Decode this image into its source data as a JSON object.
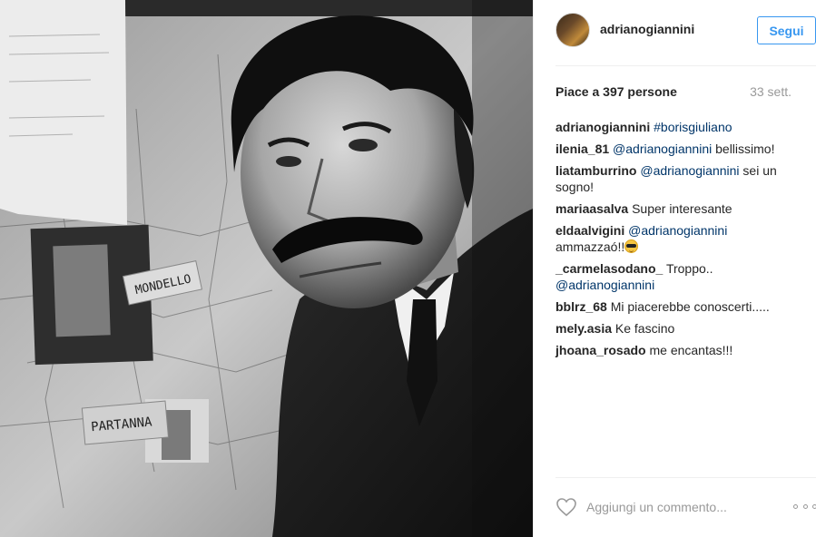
{
  "post": {
    "author": "adrianogiannini",
    "follow_label": "Segui",
    "likes_text": "Piace a 397 persone",
    "time_ago": "33 sett."
  },
  "photo": {
    "description_icon": "photo",
    "note_mondello": "MONDELLO",
    "note_partanna": "PARTANNA"
  },
  "comments": [
    {
      "user": "adrianogiannini",
      "parts": [
        {
          "type": "hashtag",
          "text": "#borisgiuliano"
        }
      ]
    },
    {
      "user": "ilenia_81",
      "parts": [
        {
          "type": "mention",
          "text": "@adrianogiannini"
        },
        {
          "type": "text",
          "text": " bellissimo!"
        }
      ]
    },
    {
      "user": "liatamburrino",
      "parts": [
        {
          "type": "mention",
          "text": "@adrianogiannini"
        },
        {
          "type": "text",
          "text": " sei un sogno!"
        }
      ]
    },
    {
      "user": "mariaasalva",
      "parts": [
        {
          "type": "text",
          "text": "Super interesante"
        }
      ]
    },
    {
      "user": "eldaalvigini",
      "parts": [
        {
          "type": "mention",
          "text": "@adrianogiannini"
        },
        {
          "type": "text",
          "text": " ammazzaó!!"
        },
        {
          "type": "emoji",
          "text": "😎"
        }
      ]
    },
    {
      "user": "_carmelasodano_",
      "parts": [
        {
          "type": "text",
          "text": "Troppo.. "
        },
        {
          "type": "mention",
          "text": "@adrianogiannini"
        }
      ]
    },
    {
      "user": "bblrz_68",
      "parts": [
        {
          "type": "text",
          "text": "Mi piacerebbe conoscerti....."
        }
      ]
    },
    {
      "user": "mely.asia",
      "parts": [
        {
          "type": "text",
          "text": "Ke fascino"
        }
      ]
    },
    {
      "user": "jhoana_rosado",
      "parts": [
        {
          "type": "text",
          "text": "me encantas!!!"
        }
      ]
    }
  ],
  "comment_bar": {
    "placeholder": "Aggiungi un commento...",
    "like_icon": "heart-outline-icon",
    "more_icon": "ellipsis-icon"
  },
  "colors": {
    "accent": "#3897f0",
    "link": "#003569",
    "muted": "#999999",
    "text": "#262626"
  }
}
